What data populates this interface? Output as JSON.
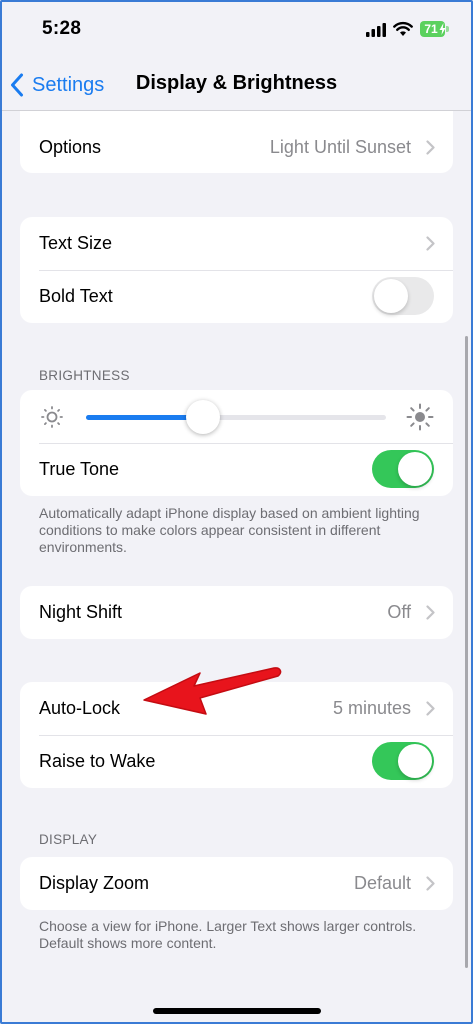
{
  "status_bar": {
    "time": "5:28",
    "battery_percent": "71"
  },
  "nav": {
    "back_label": "Settings",
    "title": "Display & Brightness"
  },
  "appearance_card": {
    "options_label": "Options",
    "options_value": "Light Until Sunset"
  },
  "text_card": {
    "text_size_label": "Text Size",
    "bold_text_label": "Bold Text",
    "bold_text_on": false
  },
  "brightness": {
    "header": "BRIGHTNESS",
    "level": 0.39,
    "true_tone_label": "True Tone",
    "true_tone_on": true,
    "footer": "Automatically adapt iPhone display based on ambient lighting conditions to make colors appear consistent in different environments."
  },
  "night_shift": {
    "label": "Night Shift",
    "value": "Off"
  },
  "lock_card": {
    "auto_lock_label": "Auto-Lock",
    "auto_lock_value": "5 minutes",
    "raise_to_wake_label": "Raise to Wake",
    "raise_to_wake_on": true
  },
  "display": {
    "header": "DISPLAY",
    "zoom_label": "Display Zoom",
    "zoom_value": "Default",
    "footer": "Choose a view for iPhone. Larger Text shows larger controls. Default shows more content."
  },
  "colors": {
    "accent": "#1a7cf0",
    "toggle_on": "#34c759",
    "annotation_arrow": "#e8141c"
  }
}
